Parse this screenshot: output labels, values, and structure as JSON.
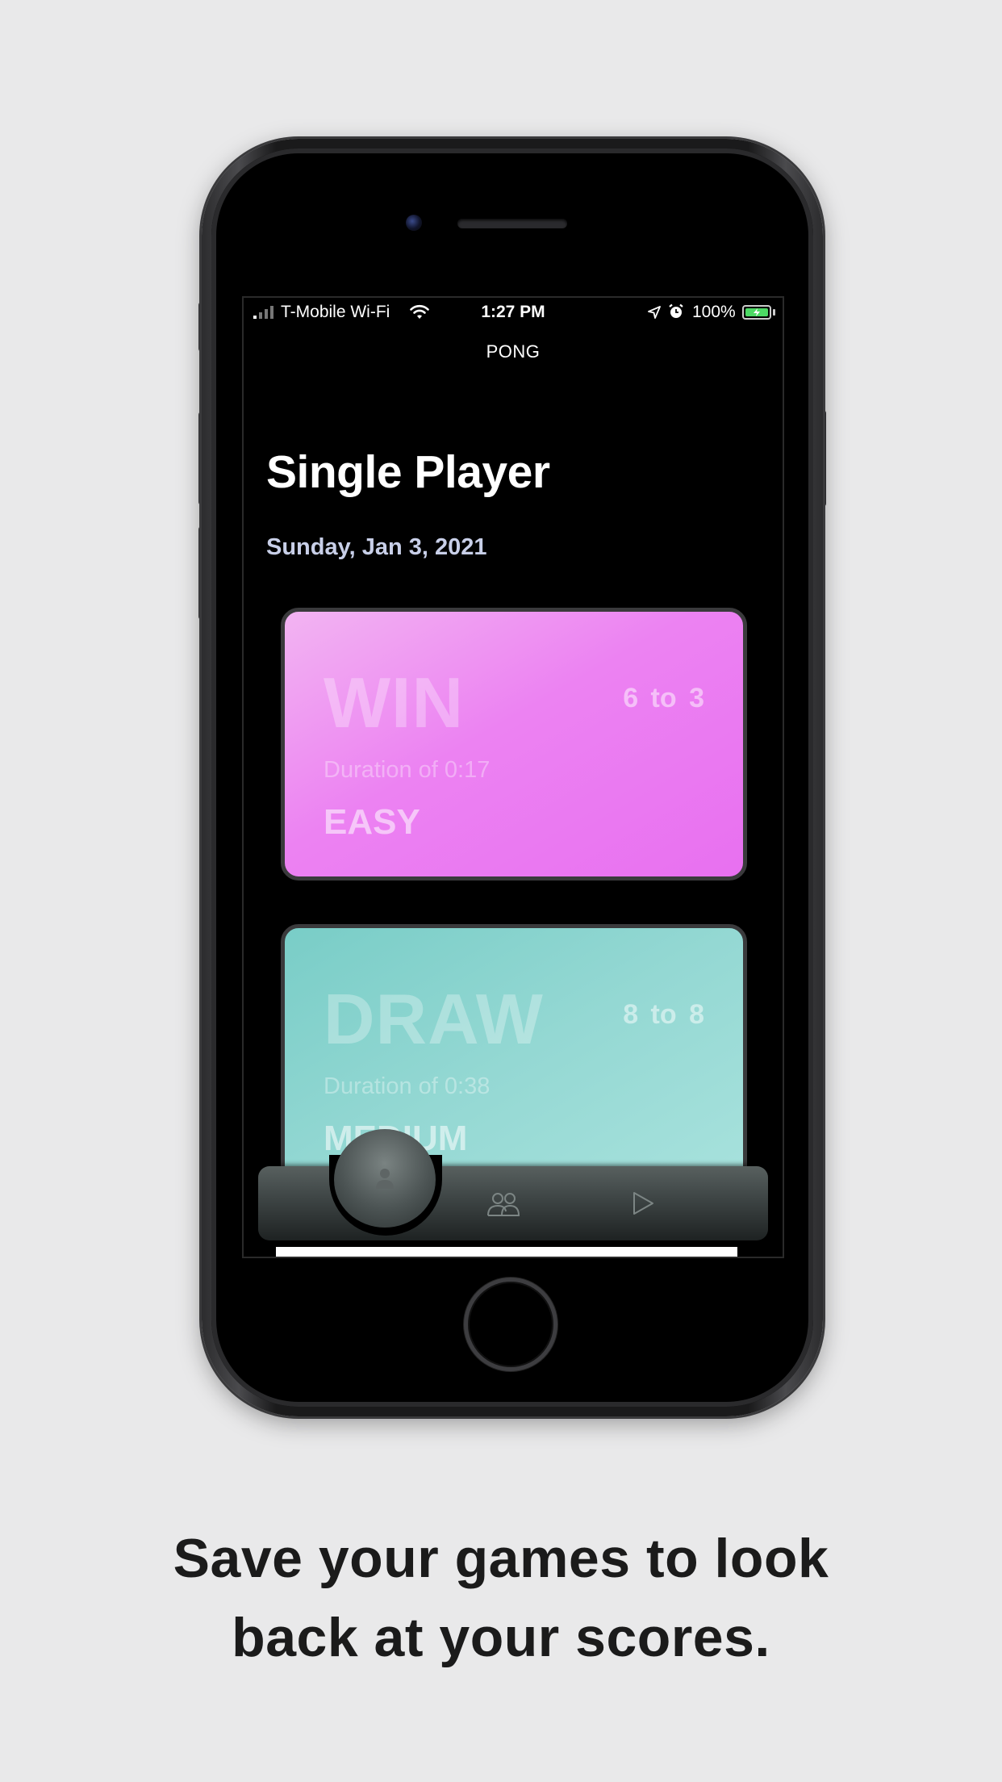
{
  "status_bar": {
    "carrier": "T-Mobile Wi-Fi",
    "time": "1:27 PM",
    "battery": "100%"
  },
  "nav": {
    "title": "PONG"
  },
  "header": {
    "title": "Single Player",
    "date": "Sunday, Jan 3, 2021"
  },
  "games": [
    {
      "result": "WIN",
      "score": "6 to 3",
      "duration": "Duration of  0:17",
      "difficulty": "EASY",
      "color": "#ec82f2"
    },
    {
      "result": "DRAW",
      "score": "8 to 8",
      "duration": "Duration of  0:38",
      "difficulty": "MEDIUM",
      "color": "#94d8d3"
    }
  ],
  "tab_bar": {
    "items": [
      "person-icon",
      "people-icon",
      "play-icon"
    ],
    "selected_index": 0
  },
  "caption": {
    "line1": "Save your games to look",
    "line2": "back at your scores."
  }
}
